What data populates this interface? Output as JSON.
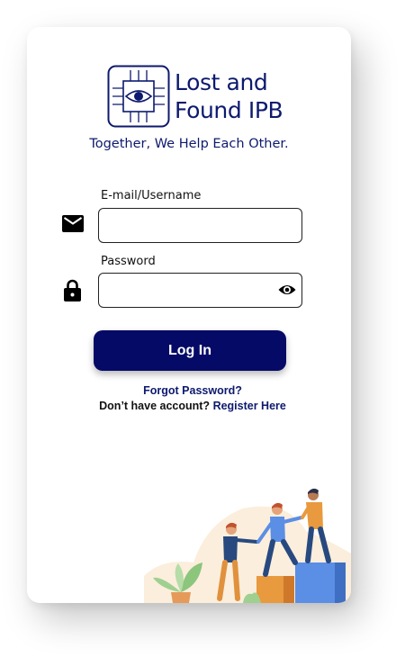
{
  "brand": {
    "name_line1": "Lost and",
    "name_line2": "Found IPB",
    "tagline": "Together, We Help Each Other.",
    "color": "#0d1a6e"
  },
  "form": {
    "email_label": "E-mail/Username",
    "email_value": "",
    "password_label": "Password",
    "password_value": "",
    "login_label": "Log In",
    "login_color": "#050a66"
  },
  "links": {
    "forgot": "Forgot Password?",
    "no_account": "Don’t have account?",
    "register": "Register Here"
  },
  "icons": {
    "email": "envelope-icon",
    "password": "lock-icon",
    "toggle": "eye-icon",
    "logo": "eye-chip-logo"
  }
}
